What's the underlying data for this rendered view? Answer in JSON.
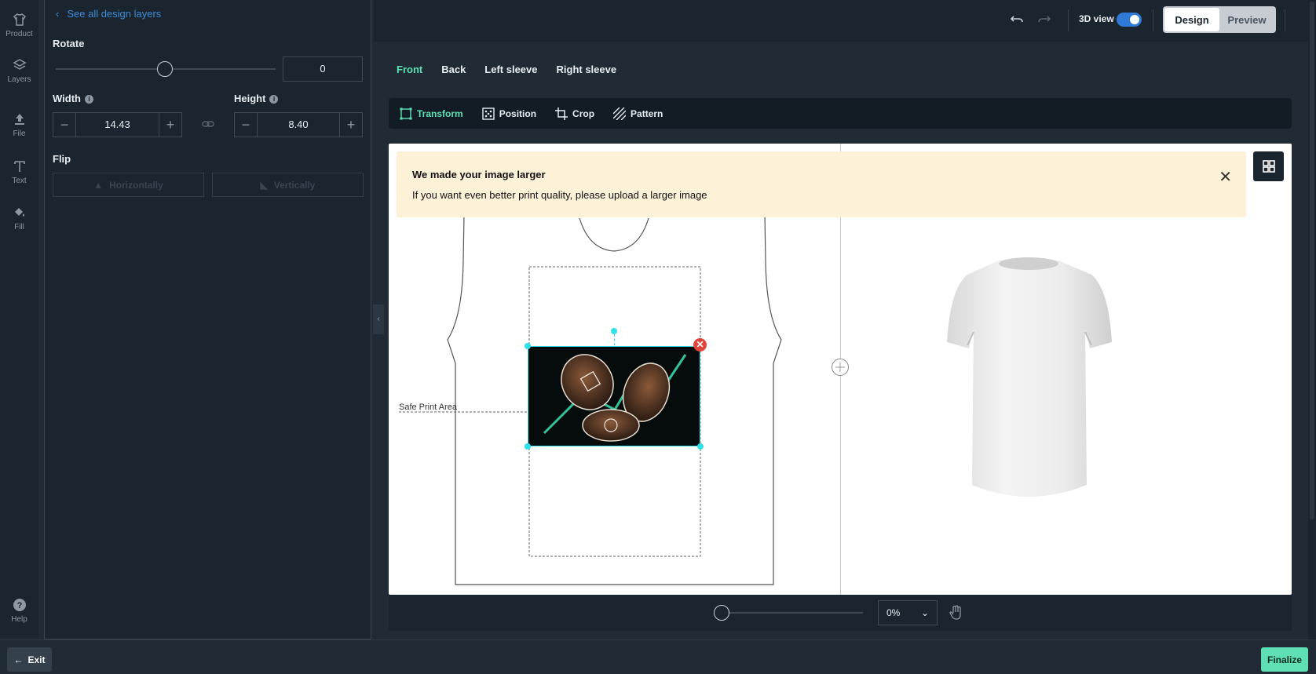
{
  "rail": {
    "product": "Product",
    "layers": "Layers",
    "file": "File",
    "text": "Text",
    "fill": "Fill",
    "help": "Help"
  },
  "panel": {
    "back_link": "See all design layers",
    "rotate_label": "Rotate",
    "rotate_value": "0",
    "width_label": "Width",
    "width_value": "14.43",
    "height_label": "Height",
    "height_value": "8.40",
    "flip_label": "Flip",
    "flip_horizontal": "Horizontally",
    "flip_vertical": "Vertically"
  },
  "topbar": {
    "view3d_label": "3D view",
    "view3d_on": true,
    "mode_design": "Design",
    "mode_preview": "Preview"
  },
  "side_tabs": [
    "Front",
    "Back",
    "Left sleeve",
    "Right sleeve"
  ],
  "tools": {
    "transform": "Transform",
    "position": "Position",
    "crop": "Crop",
    "pattern": "Pattern"
  },
  "canvas": {
    "safe_area_label": "Safe Print Area",
    "notice_title": "We made your image larger",
    "notice_body": "If you want even better print quality, please upload a larger image"
  },
  "zoom": {
    "value": "0%"
  },
  "bottom": {
    "exit": "Exit",
    "finalize": "Finalize"
  },
  "colors": {
    "accent": "#5ee0b4",
    "link": "#3d8bd6",
    "notice_bg": "#fdf1d8",
    "toggle": "#2f7ad6",
    "handle": "#2fe0e8"
  }
}
